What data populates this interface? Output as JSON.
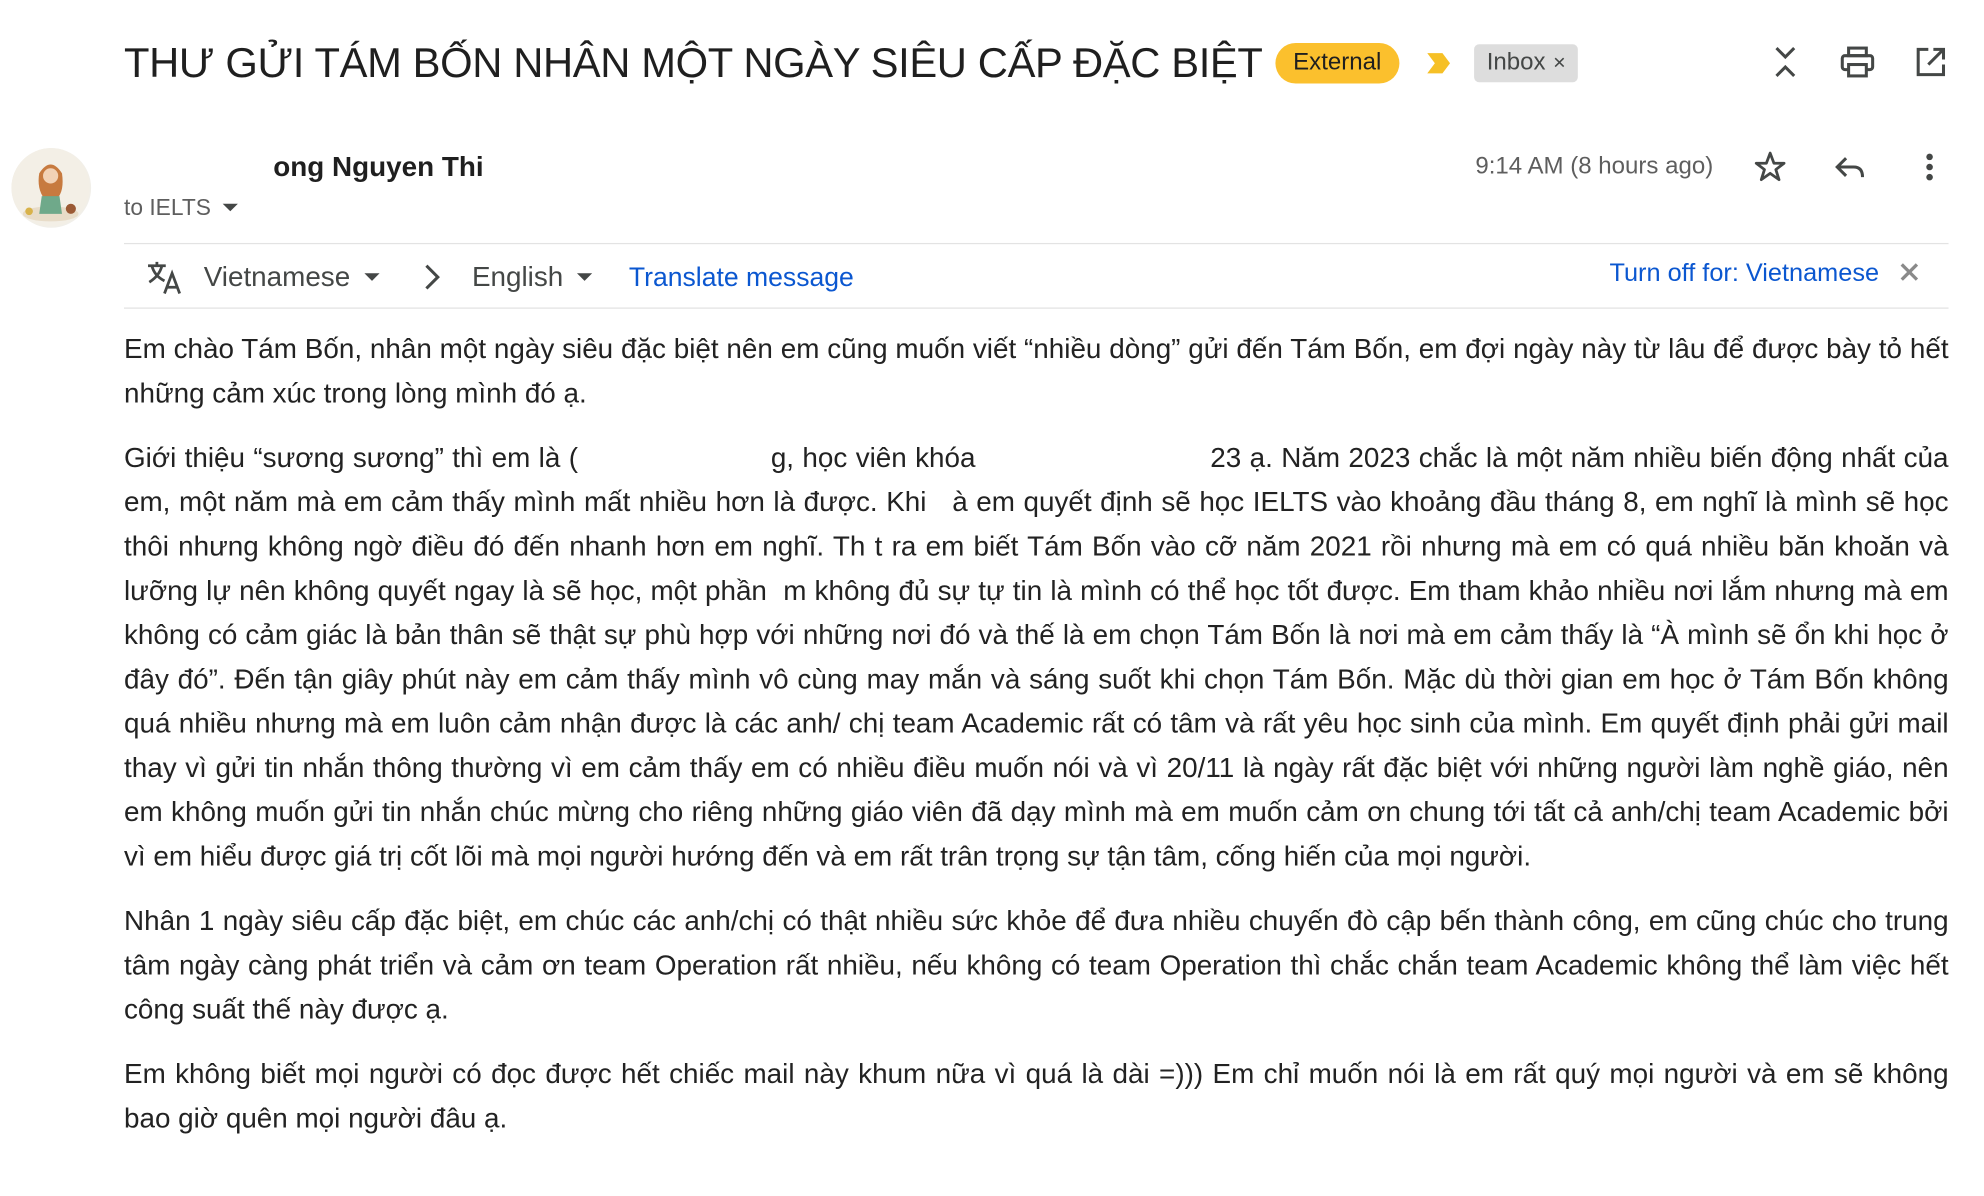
{
  "subject": "THƯ GỬI TÁM BỐN NHÂN MỘT NGÀY SIÊU CẤP ĐẶC BIỆT",
  "labels": {
    "external": "External",
    "inbox": "Inbox",
    "inbox_remove": "×"
  },
  "sender": {
    "name": "ong Nguyen Thi",
    "to": "to IELTS"
  },
  "timestamp": "9:14 AM (8 hours ago)",
  "translate": {
    "from_lang": "Vietnamese",
    "to_lang": "English",
    "translate_label": "Translate message",
    "turn_off_label": "Turn off for: Vietnamese"
  },
  "body": {
    "p1": "Em chào Tám Bốn, nhân một ngày siêu đặc biệt nên em cũng muốn viết “nhiều dòng” gửi đến Tám Bốn, em đợi ngày này từ lâu để được bày tỏ hết những cảm xúc trong lòng mình đó ạ.",
    "p2_a": "Giới thiệu “sương sương” thì em là",
    "p2_b": "g, học viên khóa",
    "p2_c": "23 ạ. Năm 2023 chắc là một năm nhiều biến động nhất của em, một năm mà em cảm thấy mình mất nhiều hơn là được. Khi",
    "p2_d": "à em quyết định sẽ học IELTS vào khoảng đầu tháng 8, em nghĩ là mình sẽ học thôi nhưng không ngờ điều đó đến nhanh hơn em nghĩ. Th",
    "p2_e": "t ra em biết Tám Bốn vào cỡ năm 2021 rồi nhưng mà em có quá nhiều băn khoăn và lưỡng lự nên không quyết ngay là sẽ học, một phần",
    "p2_f": "m không đủ sự tự tin là mình có thể học tốt được. Em tham khảo nhiều nơi lắm nhưng mà em không có cảm giác là bản thân sẽ thật sự phù hợp với những nơi đó và thế là em chọn Tám Bốn là nơi mà em cảm thấy là “À mình sẽ ổn khi học ở đây đó”. Đến tận giây phút này em cảm thấy mình vô cùng may mắn và sáng suốt khi chọn Tám Bốn. Mặc dù thời gian em học ở Tám Bốn không quá nhiều nhưng mà em luôn cảm nhận được là các anh/ chị team Academic rất có tâm và rất yêu học sinh của mình. Em quyết định phải gửi mail thay vì gửi tin nhắn thông thường vì em cảm thấy em có nhiều điều muốn nói và vì 20/11 là ngày rất đặc biệt với những người làm nghề giáo, nên em không muốn gửi tin nhắn chúc mừng cho riêng những giáo viên đã dạy mình mà em muốn cảm ơn chung tới tất cả anh/chị team Academic bởi vì em hiểu được giá trị cốt lõi mà mọi người hướng đến và em rất trân trọng sự tận tâm, cống hiến của mọi người.",
    "p3": "Nhân 1 ngày siêu cấp đặc biệt, em chúc các anh/chị có thật nhiều sức khỏe để đưa nhiều chuyến đò cập bến thành công, em cũng chúc cho trung tâm ngày càng phát triển và cảm ơn team Operation rất nhiều, nếu không có team Operation thì chắc chắn team Academic không thể làm việc hết công suất thế này được ạ.",
    "p4": "Em không biết mọi người có đọc được hết chiếc mail này khum nữa vì quá là dài =))) Em chỉ muốn nói là em rất quý mọi người và em sẽ không bao giờ quên mọi người đâu ạ."
  },
  "icons": {
    "collapse": "unfold-less-icon",
    "print": "print-icon",
    "open_new": "open-in-new-icon",
    "star": "star-outline-icon",
    "reply": "reply-icon",
    "more": "more-vert-icon",
    "translate": "translate-icon",
    "label_marker": "important-marker-icon"
  },
  "colors": {
    "external_chip": "#fbc02d",
    "important_marker": "#f6c026",
    "inbox_chip": "#dddddd",
    "link": "#0b57d0"
  }
}
